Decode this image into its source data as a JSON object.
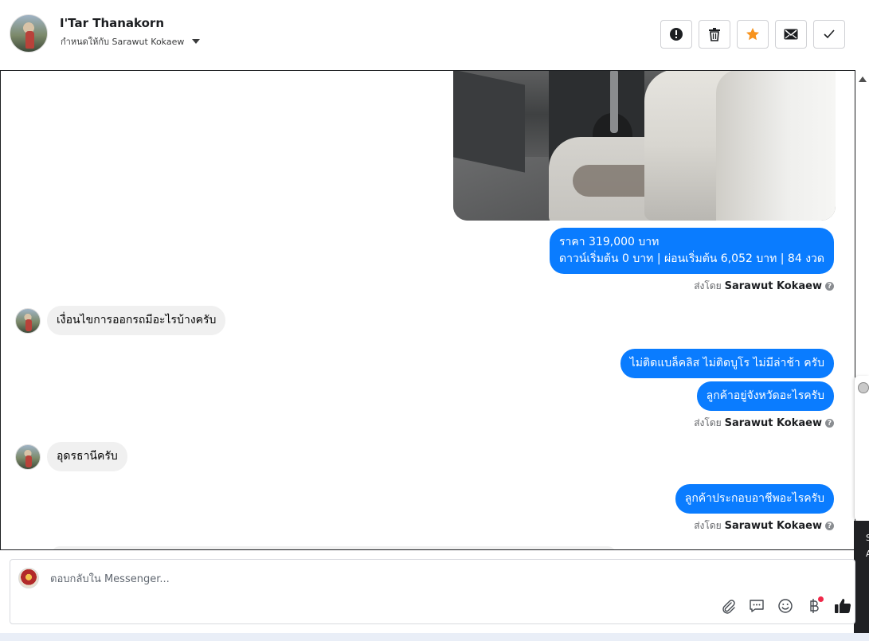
{
  "header": {
    "contact_name": "I'Tar Thanakorn",
    "assigned_to": "กำหนดให้กับ Sarawut Kokaew",
    "actions": [
      {
        "name": "mark-spam-button",
        "icon": "alert-icon",
        "color": "#1c1e21"
      },
      {
        "name": "delete-button",
        "icon": "trash-icon",
        "color": "#1c1e21"
      },
      {
        "name": "star-button",
        "icon": "star-icon",
        "color": "#f7931e"
      },
      {
        "name": "mark-unread-button",
        "icon": "envelope-icon",
        "color": "#1c1e21"
      },
      {
        "name": "mark-done-button",
        "icon": "check-icon",
        "color": "#1c1e21"
      }
    ]
  },
  "messages": {
    "price_line1": "ราคา 319,000 บาท",
    "price_line2": "ดาวน์เริ่มต้น 0 บาท | ผ่อนเริ่มต้น 6,052 บาท | 84 งวด",
    "sent_by_prefix": "ส่งโดย",
    "sent_by_name": "Sarawut Kokaew",
    "q_conditions": "เงื่อนไขการออกรถมีอะไรบ้างครับ",
    "a_no_blacklist": "ไม่ติดแบล็คลิส ไม่ติดบูโร ไม่มีล่าช้า ครับ",
    "q_province": "ลูกค้าอยู่จังหวัดอะไรครับ",
    "a_udon": "อุดรธานีครับ",
    "q_occupation": "ลูกค้าประกอบอาชีพอะไรครับ",
    "outgoing_color": "#0a7cff",
    "incoming_color": "#f0f0f0"
  },
  "composer": {
    "placeholder": "ตอบกลับใน Messenger...",
    "tools": [
      "paperclip-icon",
      "saved-reply-icon",
      "emoji-icon",
      "baht-icon",
      "thumbs-up-icon"
    ]
  },
  "side_panel": {
    "text_line1": "S",
    "text_line2": "A"
  }
}
